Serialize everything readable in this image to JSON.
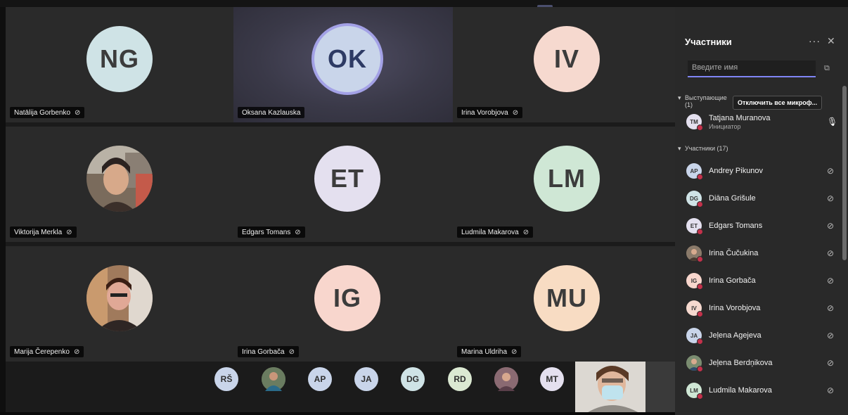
{
  "tiles": [
    {
      "initials": "NG",
      "name": "Natālija Gorbenko",
      "bg": "#cfe3e6",
      "muted": true
    },
    {
      "initials": "OK",
      "name": "Oksana Kazlauska",
      "bg": "#c9d5ea",
      "muted": false,
      "active": true
    },
    {
      "initials": "IV",
      "name": "Irina Vorobjova",
      "bg": "#f6d9cf",
      "muted": true
    },
    {
      "initials": "",
      "name": "Viktorija Merkla",
      "photo": true,
      "muted": true
    },
    {
      "initials": "ET",
      "name": "Edgars Tomans",
      "bg": "#e4e0ef",
      "muted": true
    },
    {
      "initials": "LM",
      "name": "Ludmila Makarova",
      "bg": "#cfe7d5",
      "muted": true
    },
    {
      "initials": "",
      "name": "Marija Čerepenko",
      "photo": true,
      "muted": true
    },
    {
      "initials": "IG",
      "name": "Irina Gorbača",
      "bg": "#f8d6cd",
      "muted": true
    },
    {
      "initials": "MU",
      "name": "Marina Uldriha",
      "bg": "#f8dcc3",
      "muted": true
    }
  ],
  "strip": [
    {
      "initials": "RŠ",
      "bg": "#c9d5ea"
    },
    {
      "initials": "",
      "photo": true,
      "bg": "#6a7c60"
    },
    {
      "initials": "AP",
      "bg": "#c9d5ea"
    },
    {
      "initials": "JA",
      "bg": "#c9d5ea"
    },
    {
      "initials": "DG",
      "bg": "#cfe3e6"
    },
    {
      "initials": "RD",
      "bg": "#dbe9d2"
    },
    {
      "initials": "",
      "photo": true,
      "bg": "#9a6f7a"
    },
    {
      "initials": "MT",
      "bg": "#e4e0ef"
    }
  ],
  "panel": {
    "title": "Участники",
    "more": "···",
    "close": "✕",
    "search_placeholder": "Введите имя",
    "presenters_label_1": "Выступающие",
    "presenters_label_2": "(1)",
    "mute_all": "Отключить все микроф...",
    "presenter": {
      "initials": "TM",
      "name": "Tatjana Muranova",
      "role": "Инициатор",
      "bg": "#e4e0ef"
    },
    "attendees_label": "Участники (17)",
    "attendees": [
      {
        "initials": "AP",
        "name": "Andrey Pikunov",
        "bg": "#c9d5ea"
      },
      {
        "initials": "DG",
        "name": "Diāna Grišule",
        "bg": "#cfe3e6"
      },
      {
        "initials": "ET",
        "name": "Edgars Tomans",
        "bg": "#e4e0ef"
      },
      {
        "initials": "",
        "name": "Irina Čučukina",
        "bg": "#8a7a6a",
        "photo": true
      },
      {
        "initials": "IG",
        "name": "Irina Gorbača",
        "bg": "#f8d6cd"
      },
      {
        "initials": "IV",
        "name": "Irina Vorobjova",
        "bg": "#f6d9cf"
      },
      {
        "initials": "JA",
        "name": "Jeļena Agejeva",
        "bg": "#c9d5ea"
      },
      {
        "initials": "",
        "name": "Jeļena Berdņikova",
        "bg": "#7a8c70",
        "photo": true
      },
      {
        "initials": "LM",
        "name": "Ludmila Makarova",
        "bg": "#cfe7d5"
      }
    ]
  },
  "icons": {
    "mic_muted": "🎙̸",
    "mic": "🎙"
  }
}
